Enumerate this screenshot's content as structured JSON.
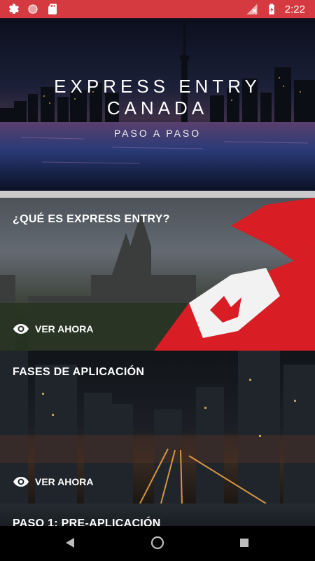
{
  "status_bar": {
    "time": "2:22",
    "icons": [
      "gear-icon",
      "record-icon",
      "sd-card-icon",
      "signal-off-icon",
      "battery-charging-icon"
    ]
  },
  "hero": {
    "title_line1": "EXPRESS ENTRY",
    "title_line2": "CANADA",
    "subtitle": "PASO A PASO"
  },
  "cards": [
    {
      "title": "¿QUÉ ES EXPRESS ENTRY?",
      "action": "VER AHORA"
    },
    {
      "title": "FASES DE APLICACIÓN",
      "action": "VER AHORA"
    },
    {
      "title": "PASO 1: PRE-APLICACIÓN"
    }
  ],
  "colors": {
    "status_bar": "#d43a3f",
    "divider": "#c9c9c9"
  }
}
